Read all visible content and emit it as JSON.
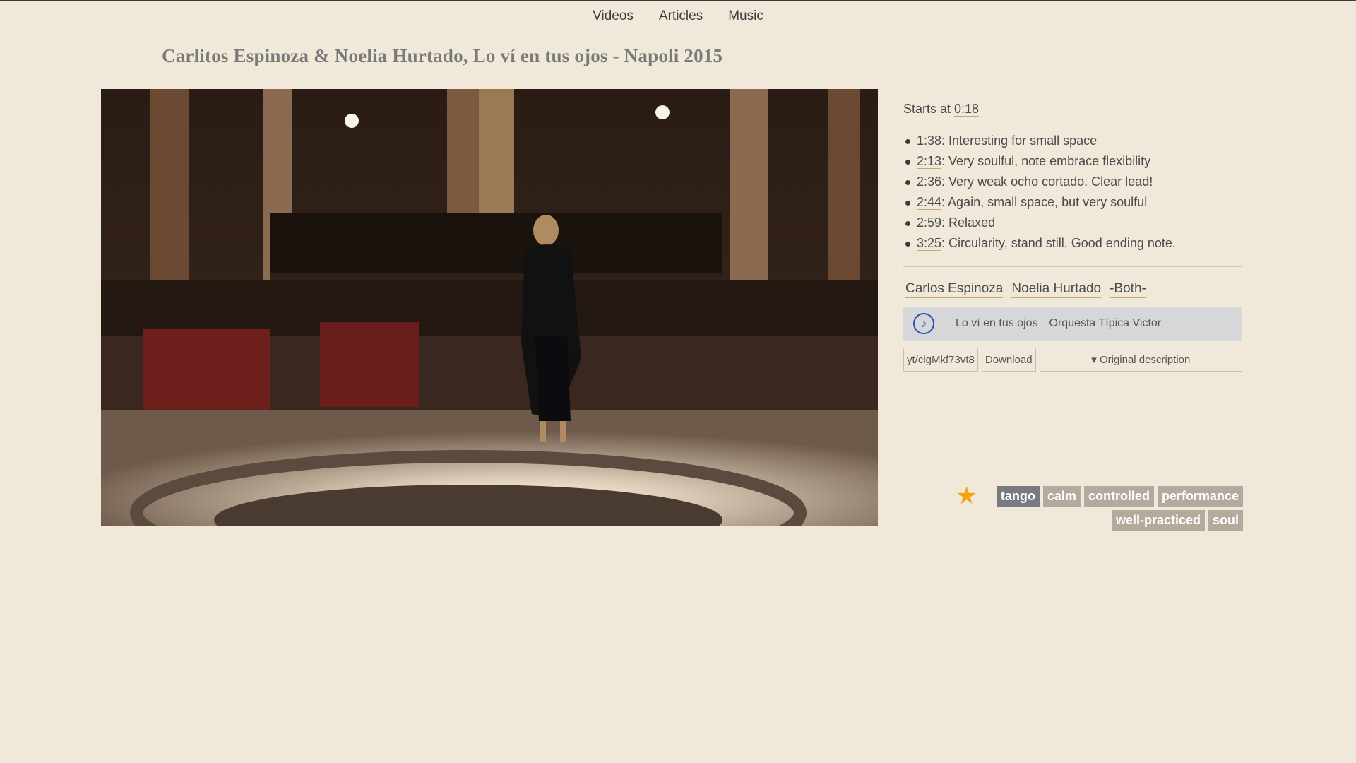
{
  "nav": {
    "videos": "Videos",
    "articles": "Articles",
    "music": "Music"
  },
  "title": "Carlitos Espinoza & Noelia Hurtado, Lo ví en tus ojos - Napoli 2015",
  "starts": {
    "prefix": "Starts at ",
    "time": "0:18"
  },
  "notes": [
    {
      "time": "1:38",
      "text": ": Interesting for small space"
    },
    {
      "time": "2:13",
      "text": ": Very soulful, note embrace flexibility"
    },
    {
      "time": "2:36",
      "text": ": Very weak ocho cortado. Clear lead!"
    },
    {
      "time": "2:44",
      "text": ": Again, small space, but very soulful"
    },
    {
      "time": "2:59",
      "text": ": Relaxed"
    },
    {
      "time": "3:25",
      "text": ": Circularity, stand still. Good ending note."
    }
  ],
  "people": {
    "leader": "Carlos Espinoza",
    "follower": "Noelia Hurtado",
    "role": "-Both-"
  },
  "song": {
    "icon": "♪",
    "title": "Lo ví en tus ojos",
    "orchestra": "Orquesta Típica Victor"
  },
  "buttons": {
    "youtube": "yt/cigMkf73vt8",
    "download": "Download",
    "description": "▾ Original description"
  },
  "tags": {
    "star": "★",
    "row1": [
      "tango",
      "calm",
      "controlled",
      "performance"
    ],
    "row2": [
      "well-practiced",
      "soul"
    ]
  },
  "colors": {
    "background": "#f0e9da",
    "star": "#f4a30c",
    "tag": "#b3aa9d",
    "tag_active": "#7a7b80",
    "music_icon": "#2a4fb8"
  }
}
